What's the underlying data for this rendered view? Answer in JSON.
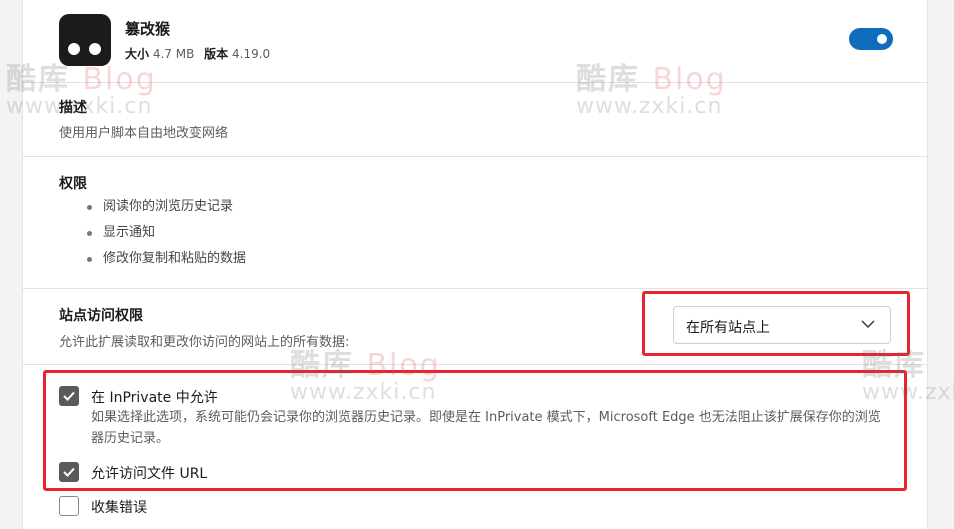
{
  "extension": {
    "name": "篡改猴",
    "size_label": "大小",
    "size_value": "4.7 MB",
    "version_label": "版本",
    "version_value": "4.19.0",
    "enabled": true
  },
  "description": {
    "title": "描述",
    "text": "使用用户脚本自由地改变网络"
  },
  "permissions": {
    "title": "权限",
    "items": [
      "阅读你的浏览历史记录",
      "显示通知",
      "修改你复制和粘贴的数据"
    ]
  },
  "site_access": {
    "title": "站点访问权限",
    "text": "允许此扩展读取和更改你访问的网站上的所有数据:",
    "selected": "在所有站点上"
  },
  "options": {
    "inprivate_label": "在 InPrivate 中允许",
    "inprivate_desc": "如果选择此选项，系统可能仍会记录你的浏览器历史记录。即使是在 InPrivate 模式下，Microsoft Edge 也无法阻止该扩展保存你的浏览器历史记录。",
    "inprivate_checked": true,
    "file_url_label": "允许访问文件 URL",
    "file_url_checked": true,
    "collect_errors_label": "收集错误",
    "collect_errors_checked": false
  },
  "watermark": {
    "line1_cn": "酷库",
    "line1_en": "Blog",
    "line2": "www.zxki.cn"
  },
  "colors": {
    "accent": "#0f6cbd",
    "highlight": "#e8242c",
    "checkbox": "#5a5a5a"
  }
}
